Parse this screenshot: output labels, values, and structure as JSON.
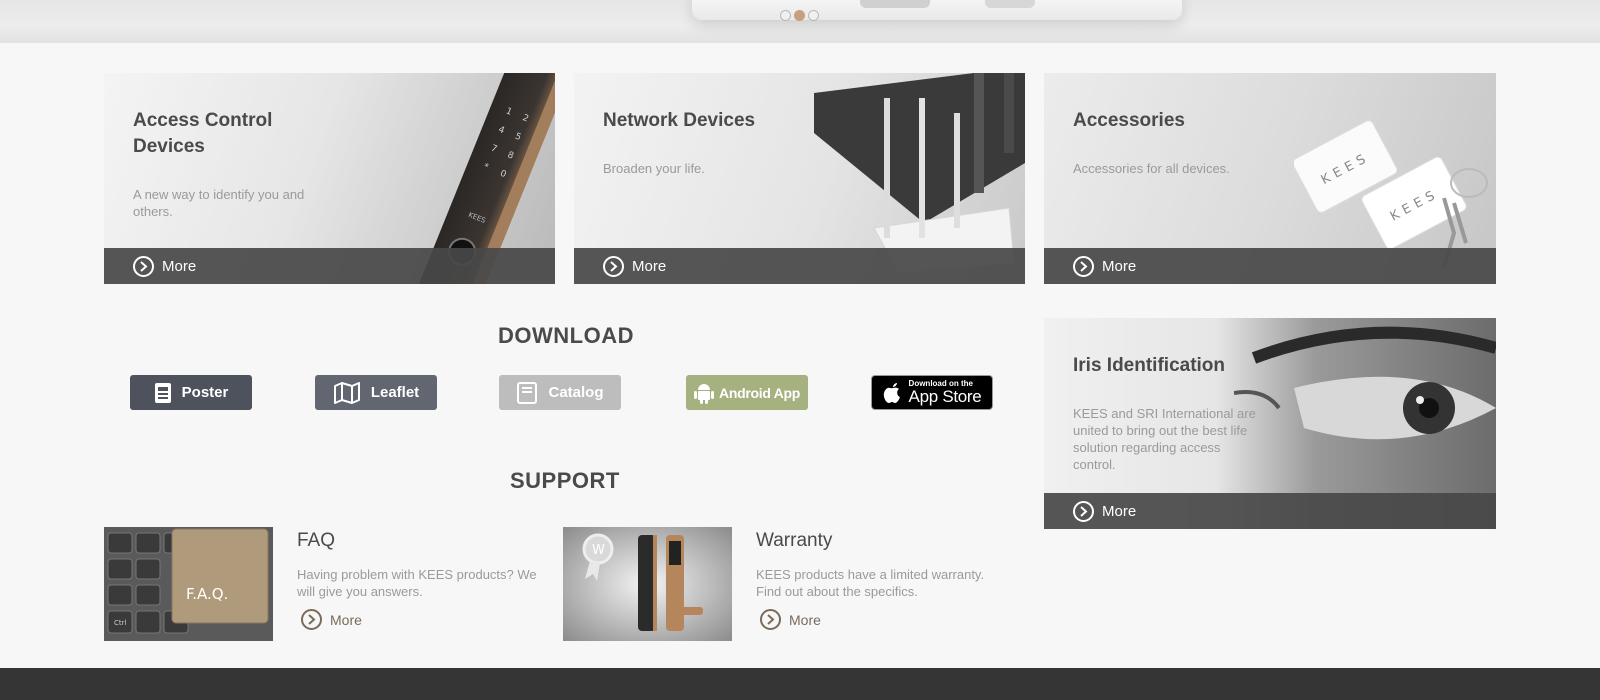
{
  "carousel": {
    "dots": 3,
    "active_index": 1
  },
  "cards": {
    "access": {
      "title_line1": "Access Control",
      "title_line2": "Devices",
      "desc_line1": "A new way to identify you and",
      "desc_line2": "others.",
      "more": "More"
    },
    "network": {
      "title": "Network Devices",
      "desc": "Broaden your life.",
      "more": "More"
    },
    "accessories": {
      "title": "Accessories",
      "desc": "Accessories for all devices.",
      "more": "More"
    },
    "iris": {
      "title": "Iris Identification",
      "desc_line1": "KEES and SRI International are",
      "desc_line2": "united to bring out the best life",
      "desc_line3": "solution regarding access",
      "desc_line4": "control.",
      "more": "More"
    }
  },
  "download": {
    "heading": "DOWNLOAD",
    "poster": "Poster",
    "leaflet": "Leaflet",
    "catalog": "Catalog",
    "android": "Android App",
    "appstore_small": "Download on the",
    "appstore_big": "App Store"
  },
  "support": {
    "heading": "SUPPORT",
    "faq": {
      "title": "FAQ",
      "desc_line1": "Having problem with KEES products? We",
      "desc_line2": "will give you answers.",
      "more": "More",
      "key_text": "F.A.Q.",
      "key_ctrl": "Ctrl"
    },
    "warranty": {
      "title": "Warranty",
      "desc_line1": "KEES products have a limited warranty.",
      "desc_line2": "Find out about the specifics.",
      "more": "More",
      "badge_letter": "W"
    }
  },
  "brand": {
    "device_text": "KEES"
  },
  "colors": {
    "accent": "#c7a07d",
    "dark_bar": "#484848",
    "footer": "#353535",
    "android": "#a5b17f"
  }
}
